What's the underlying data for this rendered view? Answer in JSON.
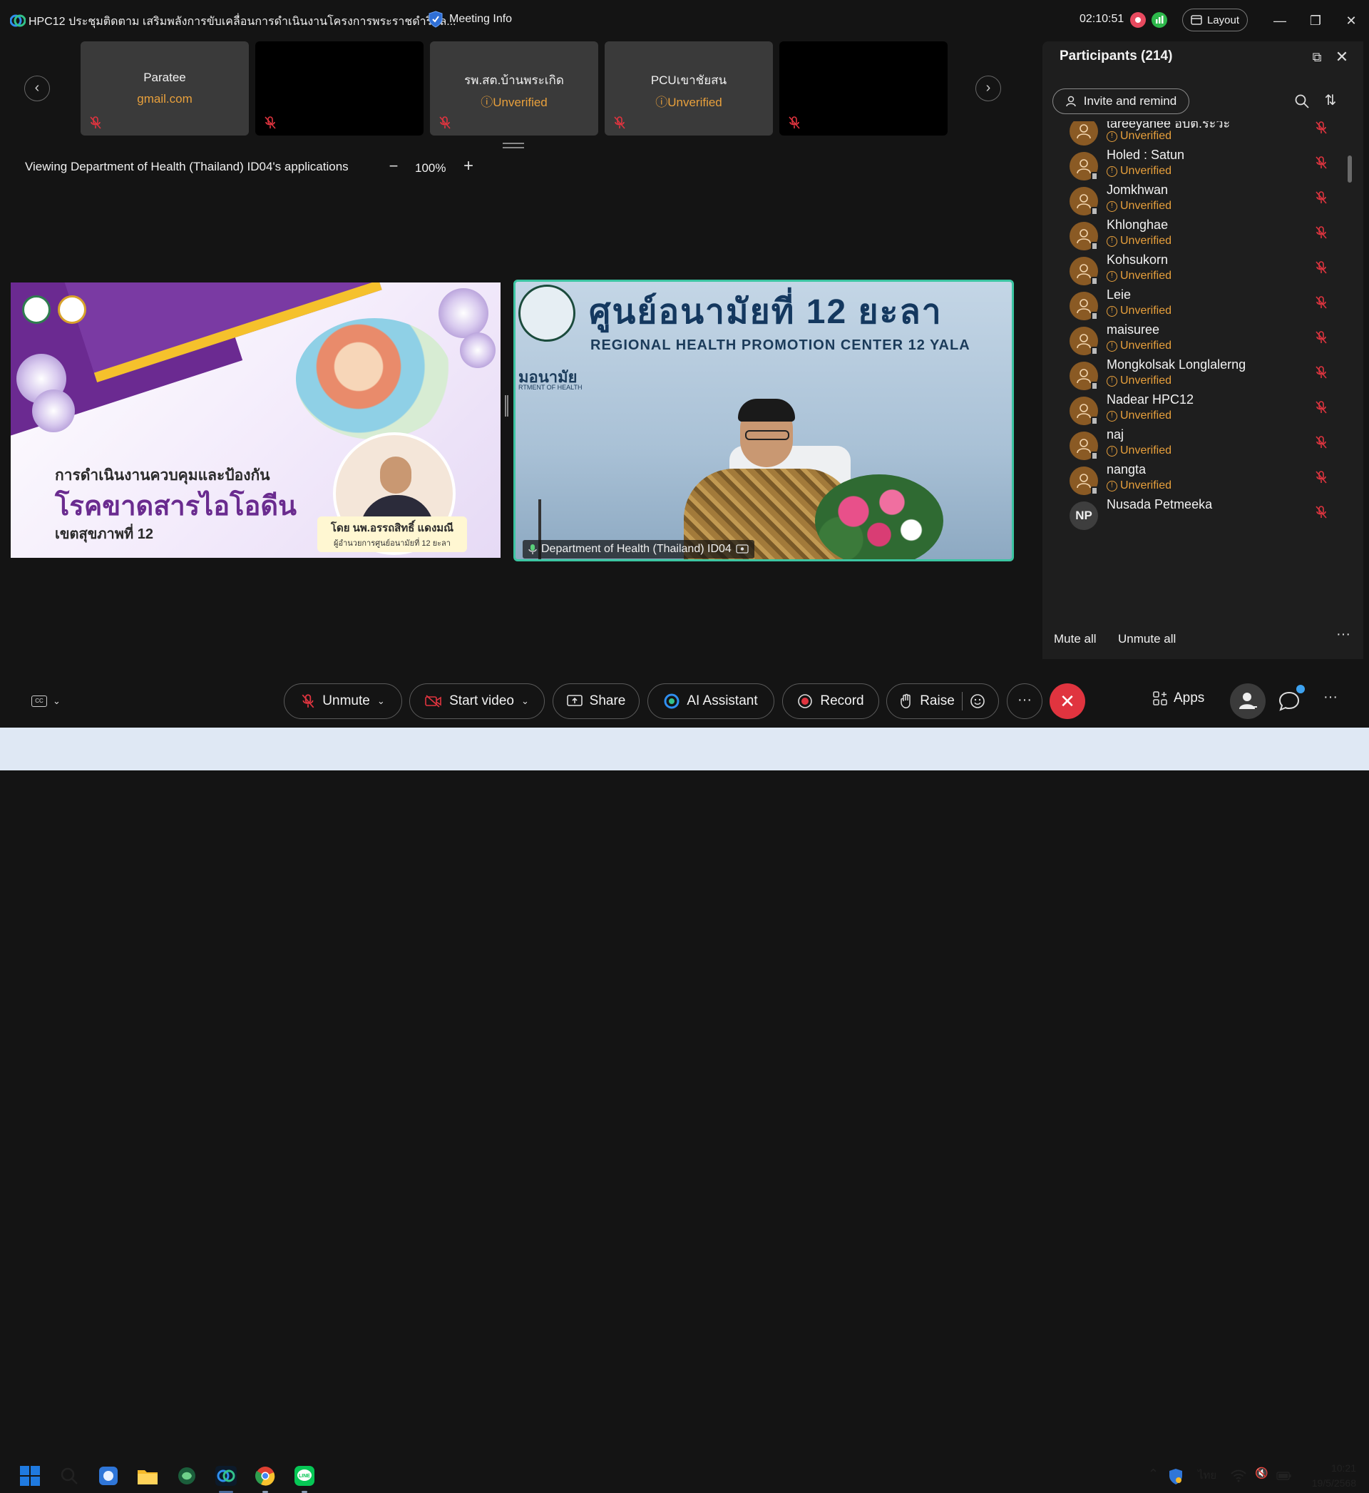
{
  "titlebar": {
    "title": "HPC12 ประชุมติดตาม เสริมพลังการขับเคลื่อนการดำเนินงานโครงการพระราชดำริแล...",
    "meeting_info": "Meeting Info",
    "clock": "02:10:51",
    "layout_label": "Layout"
  },
  "thumbnails": [
    {
      "name": "Paratee",
      "sub": "gmail.com",
      "dark": false
    },
    {
      "name": "",
      "sub": "",
      "dark": true
    },
    {
      "name": "รพ.สต.บ้านพระเกิด",
      "sub": "Unverified",
      "dark": false
    },
    {
      "name": "PCUเขาชัยสน",
      "sub": "Unverified",
      "dark": false
    },
    {
      "name": "",
      "sub": "",
      "dark": true
    }
  ],
  "viewing": {
    "text": "Viewing Department of Health (Thailand) ID04's applications",
    "zoom": "100%"
  },
  "slide": {
    "line1": "การดำเนินงานควบคุมและป้องกัน",
    "line2": "โรคขาดสารไอโอดีน",
    "line3": "เขตสุขภาพที่ 12",
    "byline1": "โดย นพ.อรรถสิทธิ์ แดงมณี",
    "byline2": "ผู้อำนวยการศูนย์อนามัยที่ 12 ยะลา"
  },
  "video": {
    "banner_th": "ศูนย์อนามัยที่ 12 ยะลา",
    "banner_en": "REGIONAL HEALTH PROMOTION CENTER 12 YALA",
    "banner_sub1": "มอนามัย",
    "banner_sub2": "RTMENT OF HEALTH",
    "label": "Department of Health (Thailand) ID04"
  },
  "participants": {
    "title": "Participants (214)",
    "invite_label": "Invite and remind",
    "mute_all": "Mute all",
    "unmute_all": "Unmute all",
    "list": [
      {
        "name": "tareeyanee อบต.ระวะ",
        "status": "Unverified"
      },
      {
        "name": "Holed : Satun",
        "status": "Unverified"
      },
      {
        "name": "Jomkhwan",
        "status": "Unverified"
      },
      {
        "name": "Khlonghae",
        "status": "Unverified"
      },
      {
        "name": "Kohsukorn",
        "status": "Unverified"
      },
      {
        "name": "Leie",
        "status": "Unverified"
      },
      {
        "name": "maisuree",
        "status": "Unverified"
      },
      {
        "name": "Mongkolsak Longlalerng",
        "status": "Unverified"
      },
      {
        "name": "Nadear HPC12",
        "status": "Unverified"
      },
      {
        "name": "naj",
        "status": "Unverified"
      },
      {
        "name": "nangta",
        "status": "Unverified"
      },
      {
        "name": "Nusada Petmeeka",
        "status": "",
        "initials": "NP"
      }
    ]
  },
  "toolbar": {
    "unmute": "Unmute",
    "start_video": "Start video",
    "share": "Share",
    "ai_assistant": "AI Assistant",
    "record": "Record",
    "raise": "Raise",
    "apps": "Apps"
  },
  "taskbar": {
    "lang": "ไทย",
    "time": "10:21",
    "date": "19/5/2568"
  },
  "colors": {
    "accent_unverified": "#e8a03c",
    "active_speaker_border": "#3cc5a2",
    "end_call": "#e0343f",
    "mic_muted": "#e0343f"
  }
}
